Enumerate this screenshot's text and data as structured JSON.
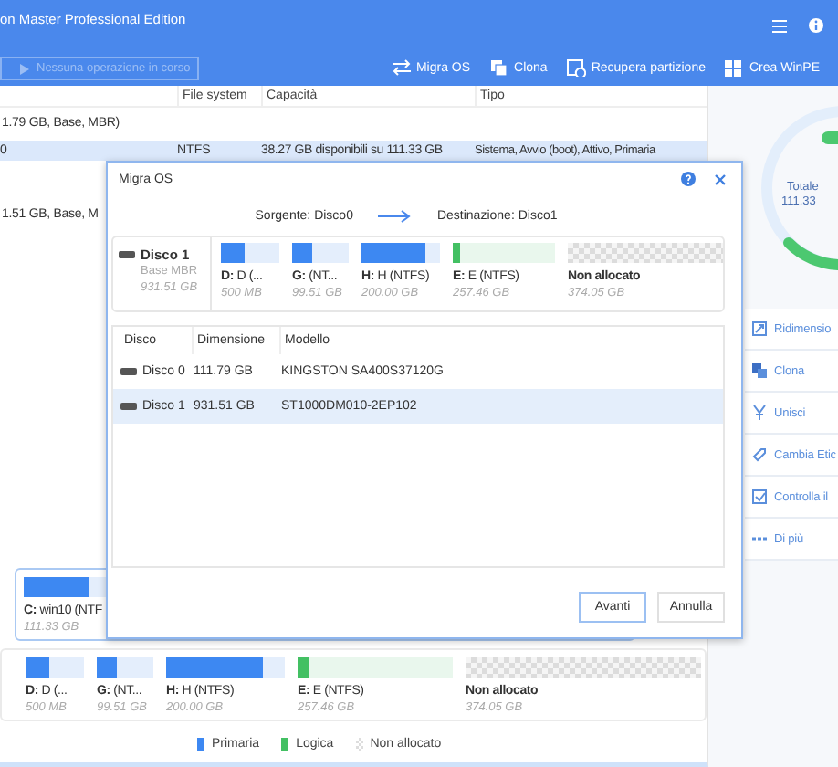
{
  "app": {
    "title": "on Master Professional Edition"
  },
  "toolbar": {
    "pending": {
      "label": "Nessuna operazione in corso",
      "disabled": true
    },
    "actions": [
      {
        "label": "Migra OS"
      },
      {
        "label": "Clona"
      },
      {
        "label": "Recupera partizione"
      },
      {
        "label": "Crea WinPE"
      }
    ]
  },
  "partition_table": {
    "columns": [
      "File system",
      "Capacità",
      "Tipo"
    ],
    "rows": [
      {
        "kind": "disk",
        "selected": false,
        "name": "1.79 GB, Base, MBR)"
      },
      {
        "kind": "partition",
        "selected": true,
        "name": "0",
        "file_system": "NTFS",
        "capacity": "38.27 GB disponibili su 111.33 GB",
        "type": "Sistema, Avvio (boot), Attivo, Primaria"
      },
      {
        "kind": "disk",
        "selected": false,
        "name": "1.51 GB, Base, M"
      }
    ]
  },
  "disk_maps": [
    {
      "selected": true,
      "partitions": [
        {
          "label": "**C:** win10 (NTF",
          "size": "111.33 GB",
          "kind": "primary",
          "level": 0.3
        }
      ]
    },
    {
      "selected": false,
      "partitions": [
        {
          "label": "**D:** D (...",
          "size": "500 MB",
          "kind": "primary",
          "level": 0.4
        },
        {
          "label": "**G:**  (NT...",
          "size": "99.51 GB",
          "kind": "primary",
          "level": 0.37
        },
        {
          "label": "**H:** H (NTFS)",
          "size": "200.00 GB",
          "kind": "primary",
          "level": 0.82
        },
        {
          "label": "**E:** E (NTFS)",
          "size": "257.46 GB",
          "kind": "logical",
          "level": 0.07
        },
        {
          "label": "Non allocato",
          "size": "374.05 GB",
          "kind": "unallocated"
        }
      ]
    }
  ],
  "legend": [
    {
      "label": "Primaria",
      "kind": "primary"
    },
    {
      "label": "Logica",
      "kind": "logical"
    },
    {
      "label": "Non allocato",
      "kind": "unallocated"
    }
  ],
  "side_panel": {
    "total_label": "Totale",
    "total_value": "111.33",
    "actions": [
      "Ridimensio",
      "Clona",
      "Unisci",
      "Cambia Etic",
      "Controlla il",
      "Di più"
    ]
  },
  "dialog": {
    "title": "Migra OS",
    "source": "Sorgente: Disco0",
    "destination": "Destinazione: Disco1",
    "disk": {
      "name": "Disco 1",
      "type": "Base MBR",
      "size": "931.51 GB",
      "partitions": [
        {
          "label": "**D:** D (...",
          "size": "500 MB",
          "kind": "primary",
          "level": 0.4
        },
        {
          "label": "**G:**  (NT...",
          "size": "99.51 GB",
          "kind": "primary",
          "level": 0.37
        },
        {
          "label": "**H:** H (NTFS)",
          "size": "200.00 GB",
          "kind": "primary",
          "level": 0.82
        },
        {
          "label": "**E:** E (NTFS)",
          "size": "257.46 GB",
          "kind": "logical",
          "level": 0.07
        },
        {
          "label": "Non allocato",
          "size": "374.05 GB",
          "kind": "unallocated"
        }
      ]
    },
    "table": {
      "columns": [
        "Disco",
        "Dimensione",
        "Modello"
      ],
      "rows": [
        {
          "disk": "Disco 0",
          "size": "111.79 GB",
          "model": "KINGSTON SA400S37120G",
          "selected": false
        },
        {
          "disk": "Disco 1",
          "size": "931.51 GB",
          "model": "ST1000DM010-2EP102",
          "selected": true
        }
      ]
    },
    "buttons": [
      {
        "label": "Avanti",
        "kind": "primary"
      },
      {
        "label": "Annulla",
        "kind": "secondary"
      }
    ]
  }
}
